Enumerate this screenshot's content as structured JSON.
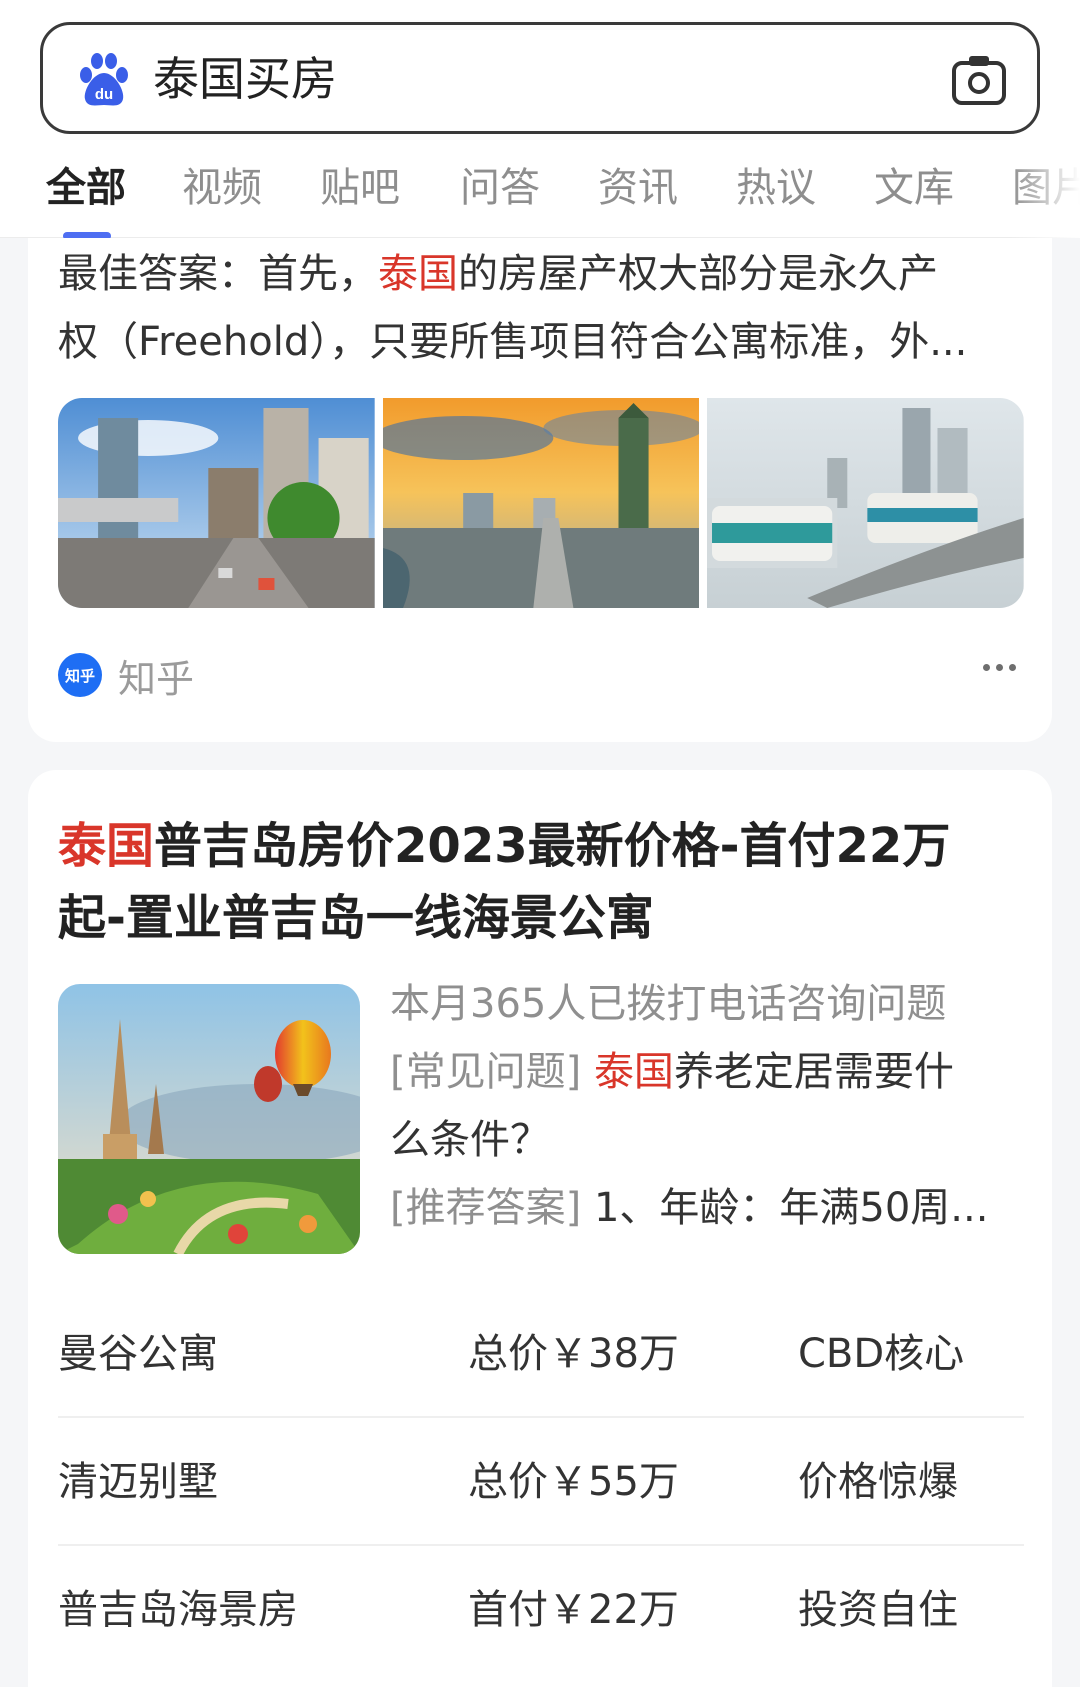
{
  "search": {
    "query": "泰国买房"
  },
  "tabs": [
    "全部",
    "视频",
    "贴吧",
    "问答",
    "资讯",
    "热议",
    "文库",
    "图片"
  ],
  "card1": {
    "answer_prefix": "最佳答案：首先，",
    "answer_highlight": "泰国",
    "answer_line1_rest": "的房屋产权大部分是永久产",
    "answer_line2": "权（Freehold），只要所售项目符合公寓标准，外...",
    "source_icon_text": "知乎",
    "source_name": "知乎"
  },
  "card2": {
    "title_highlight": "泰国",
    "title_line1_rest": "普吉岛房价2023最新价格-首付22万",
    "title_line2": "起-置业普吉岛一线海景公寓",
    "stat": "本月365人已拨打电话咨询问题",
    "faq_tag": "[常见问题]",
    "faq_highlight": "泰国",
    "faq_text_1": "养老定居需要什",
    "faq_text_2": "么条件？",
    "answer_tag": "[推荐答案]",
    "answer_text": "1、年龄：年满50周..."
  },
  "listings": [
    {
      "name": "曼谷公寓",
      "price": "总价￥38万",
      "tag": "CBD核心"
    },
    {
      "name": "清迈别墅",
      "price": "总价￥55万",
      "tag": "价格惊爆"
    },
    {
      "name": "普吉岛海景房",
      "price": "首付￥22万",
      "tag": "投资自住"
    }
  ],
  "colors": {
    "accent": "#4e6ef2",
    "highlight": "#d9362a",
    "zhihu": "#1e6ef4"
  }
}
